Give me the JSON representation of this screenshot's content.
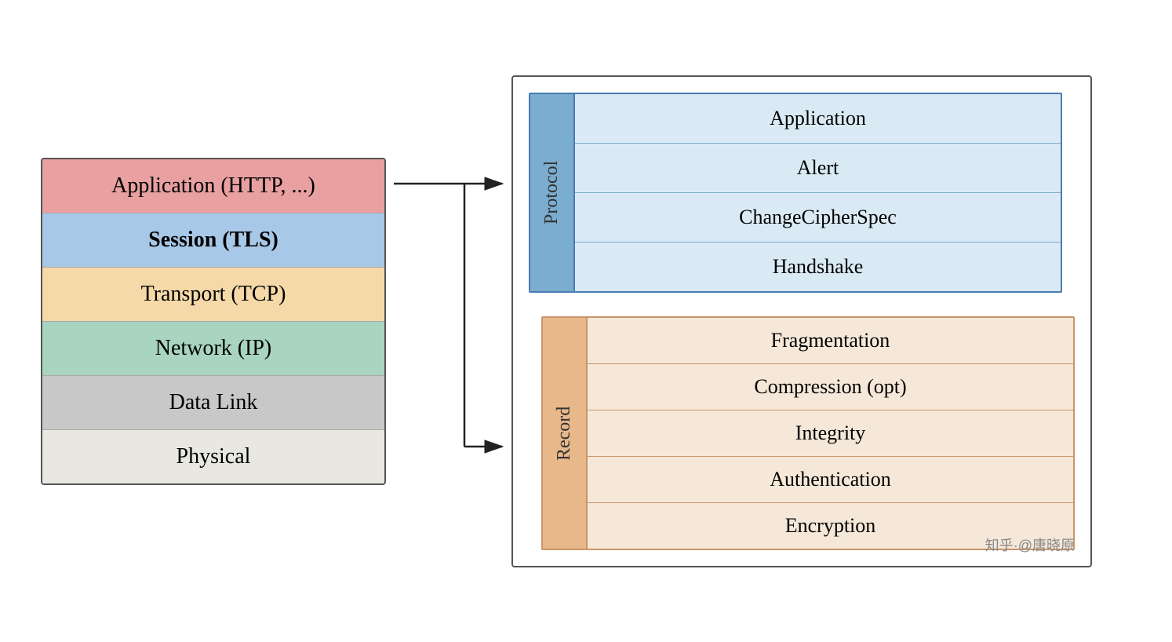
{
  "left_stack": {
    "layers": [
      {
        "id": "app",
        "label": "Application (HTTP, ...)",
        "class": "layer-app",
        "bold": false
      },
      {
        "id": "session",
        "label": "Session (TLS)",
        "class": "layer-session",
        "bold": true
      },
      {
        "id": "transport",
        "label": "Transport (TCP)",
        "class": "layer-transport",
        "bold": false
      },
      {
        "id": "network",
        "label": "Network (IP)",
        "class": "layer-network",
        "bold": false
      },
      {
        "id": "datalink",
        "label": "Data Link",
        "class": "layer-datalink",
        "bold": false
      },
      {
        "id": "physical",
        "label": "Physical",
        "class": "layer-physical",
        "bold": false
      }
    ]
  },
  "protocol": {
    "label": "Protocol",
    "items": [
      "Application",
      "Alert",
      "ChangeCipherSpec",
      "Handshake"
    ]
  },
  "record": {
    "label": "Record",
    "items": [
      "Fragmentation",
      "Compression (opt)",
      "Integrity",
      "Authentication",
      "Encryption"
    ]
  },
  "watermark": "知乎·@唐晓原"
}
